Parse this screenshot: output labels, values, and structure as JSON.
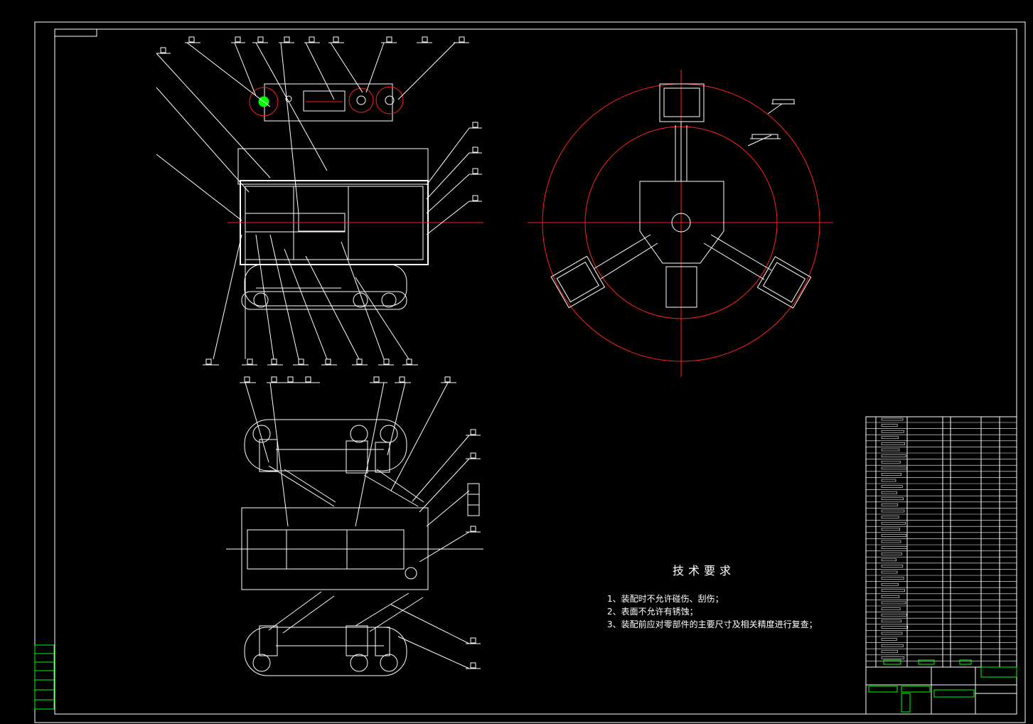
{
  "technical_requirements": {
    "title": "技术要求",
    "items": [
      "1、装配时不允许碰伤、刮伤；",
      "2、表面不允许有锈蚀；",
      "3、装配前应对零部件的主要尺寸及相关精度进行复查；"
    ]
  },
  "colors": {
    "background": "#000000",
    "line": "#ffffff",
    "centerline": "#ff2020",
    "accent": "#00ff00",
    "cyan": "#00ffff"
  }
}
